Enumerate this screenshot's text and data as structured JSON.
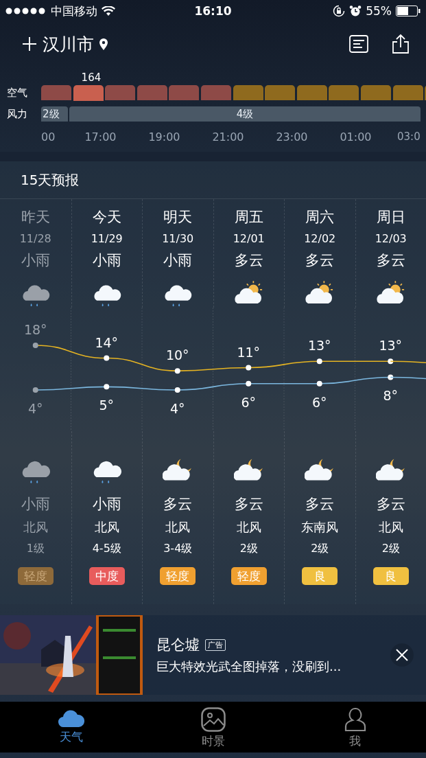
{
  "status_bar": {
    "carrier": "中国移动",
    "time": "16:10",
    "battery": "55%"
  },
  "header": {
    "city": "汉川市"
  },
  "hourly": {
    "air_label": "空气",
    "wind_label": "风力",
    "air_bars": [
      {
        "color": "#8e4a47",
        "selected": false
      },
      {
        "color": "#c9604f",
        "selected": true,
        "value": "164"
      },
      {
        "color": "#8e4a47",
        "selected": false
      },
      {
        "color": "#8e4a47",
        "selected": false
      },
      {
        "color": "#8e4a47",
        "selected": false
      },
      {
        "color": "#8e4a47",
        "selected": false
      },
      {
        "color": "#8f6a1e",
        "selected": false
      },
      {
        "color": "#8f6a1e",
        "selected": false
      },
      {
        "color": "#8f6a1e",
        "selected": false
      },
      {
        "color": "#8f6a1e",
        "selected": false
      },
      {
        "color": "#8f6a1e",
        "selected": false
      },
      {
        "color": "#8f6a1e",
        "selected": false
      },
      {
        "color": "#8f6a1e",
        "selected": false
      }
    ],
    "wind_segments": [
      "2级",
      "4级"
    ],
    "times": [
      "00",
      "17:00",
      "19:00",
      "21:00",
      "23:00",
      "01:00",
      "03:0"
    ]
  },
  "forecast": {
    "title": "15天预报",
    "days": [
      {
        "name": "昨天",
        "date": "11/28",
        "day_weather": {
          "label": "小雨",
          "kind": "rain"
        },
        "night_weather": {
          "label": "小雨",
          "kind": "rain"
        },
        "wind_dir": "北风",
        "wind_level": "1级",
        "aqi": {
          "label": "轻度",
          "color": "#8e6a3a"
        },
        "past": true
      },
      {
        "name": "今天",
        "date": "11/29",
        "day_weather": {
          "label": "小雨",
          "kind": "rain"
        },
        "night_weather": {
          "label": "小雨",
          "kind": "rain"
        },
        "wind_dir": "北风",
        "wind_level": "4-5级",
        "aqi": {
          "label": "中度",
          "color": "#e85c5c"
        },
        "past": false
      },
      {
        "name": "明天",
        "date": "11/30",
        "day_weather": {
          "label": "小雨",
          "kind": "rain"
        },
        "night_weather": {
          "label": "多云",
          "kind": "moon"
        },
        "wind_dir": "北风",
        "wind_level": "3-4级",
        "aqi": {
          "label": "轻度",
          "color": "#f0a030"
        },
        "past": false
      },
      {
        "name": "周五",
        "date": "12/01",
        "day_weather": {
          "label": "多云",
          "kind": "sun"
        },
        "night_weather": {
          "label": "多云",
          "kind": "moon"
        },
        "wind_dir": "北风",
        "wind_level": "2级",
        "aqi": {
          "label": "轻度",
          "color": "#f0a030"
        },
        "past": false
      },
      {
        "name": "周六",
        "date": "12/02",
        "day_weather": {
          "label": "多云",
          "kind": "sun"
        },
        "night_weather": {
          "label": "多云",
          "kind": "moon"
        },
        "wind_dir": "东南风",
        "wind_level": "2级",
        "aqi": {
          "label": "良",
          "color": "#f0c040"
        },
        "past": false
      },
      {
        "name": "周日",
        "date": "12/03",
        "day_weather": {
          "label": "多云",
          "kind": "sun"
        },
        "night_weather": {
          "label": "多云",
          "kind": "moon"
        },
        "wind_dir": "北风",
        "wind_level": "2级",
        "aqi": {
          "label": "良",
          "color": "#f0c040"
        },
        "past": false
      }
    ],
    "chart_data": {
      "type": "line",
      "series": [
        {
          "color": "#e6b422",
          "marker": "circle",
          "values": [
            18,
            14,
            10,
            11,
            13,
            13
          ],
          "value_labels": [
            "18°",
            "14°",
            "10°",
            "11°",
            "13°",
            "13°"
          ]
        },
        {
          "color": "#7cb8e0",
          "marker": "circle",
          "values": [
            4,
            5,
            4,
            6,
            6,
            8
          ],
          "value_labels": [
            "4°",
            "5°",
            "4°",
            "6°",
            "6°",
            "8°"
          ]
        }
      ]
    }
  },
  "ad": {
    "title": "昆仑墟",
    "tag": "广告",
    "text": "巨大特效光武全图掉落，没刷到..."
  },
  "tab_bar": [
    {
      "label": "天气",
      "selected": true
    },
    {
      "label": "时景",
      "selected": false
    },
    {
      "label": "我",
      "selected": false
    }
  ]
}
